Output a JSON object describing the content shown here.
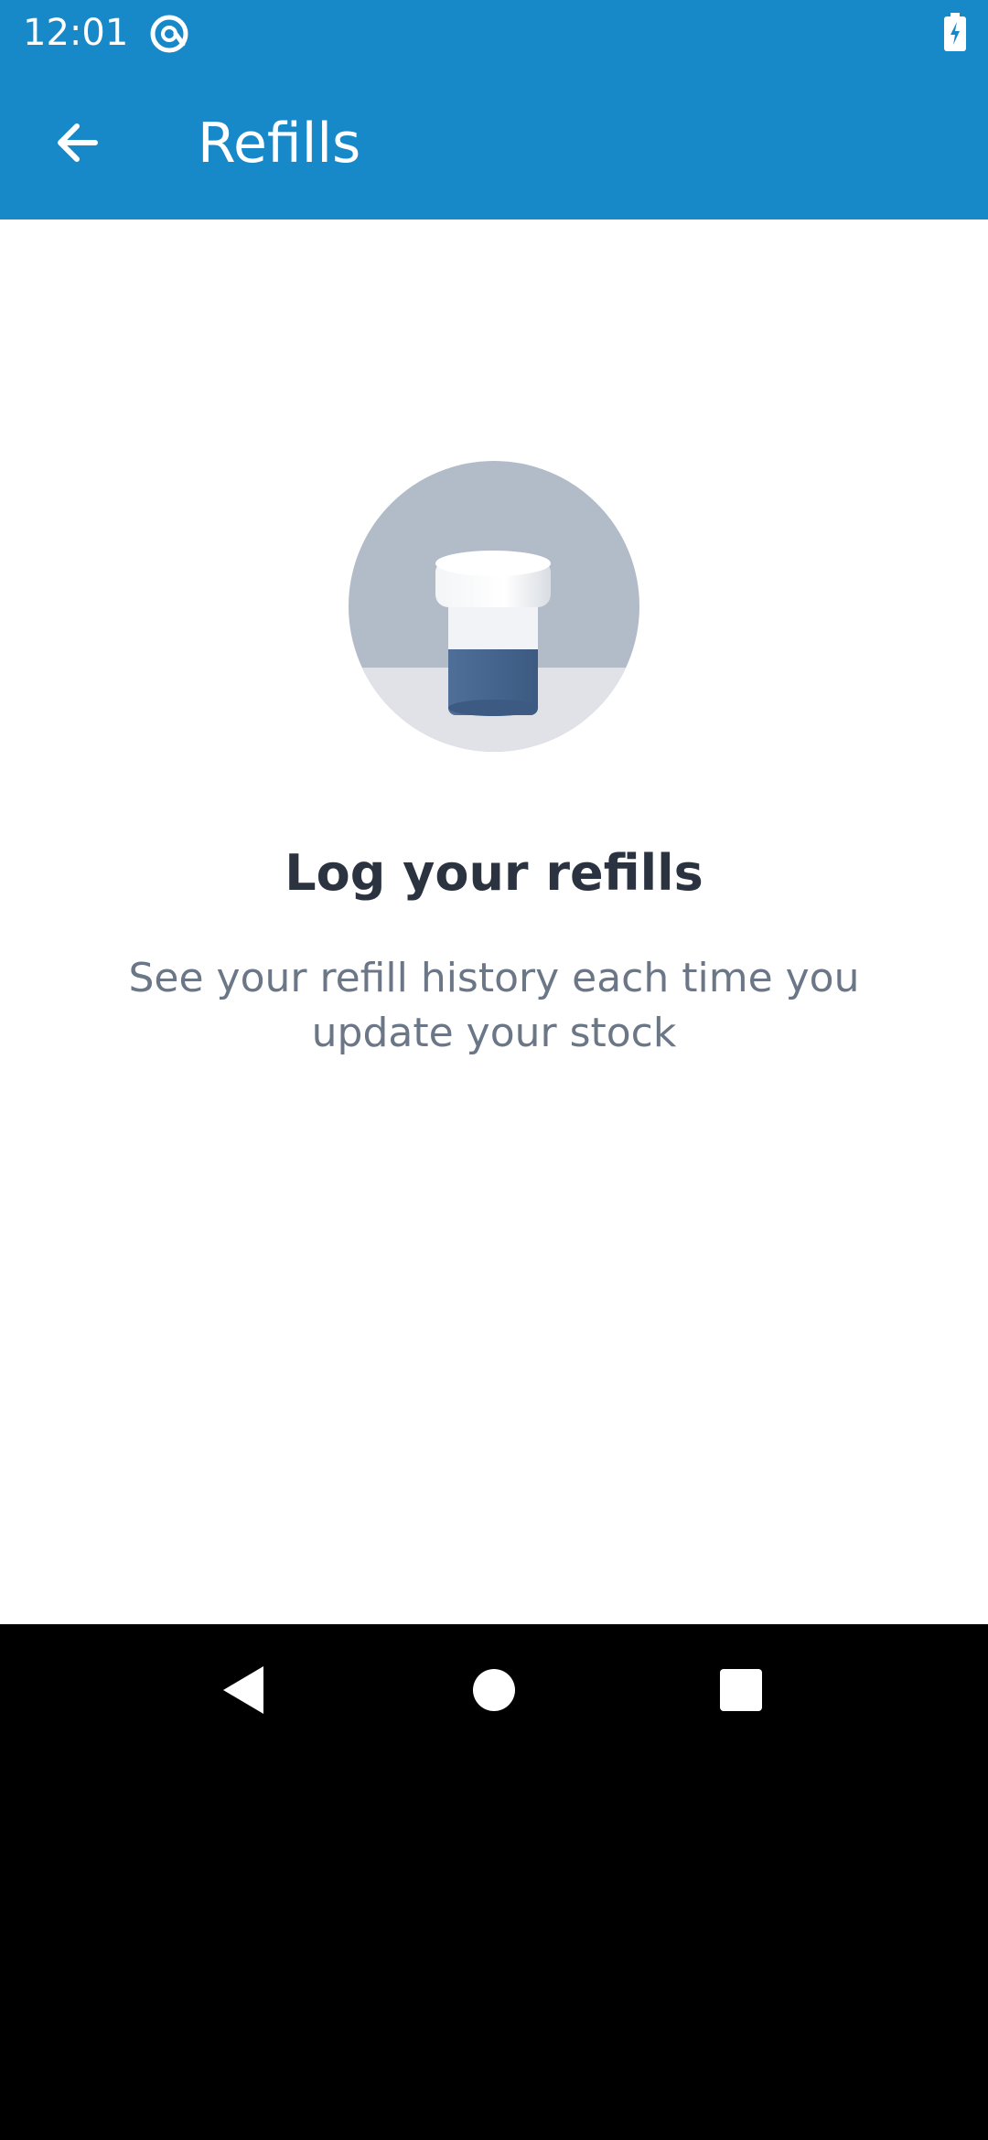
{
  "status_bar": {
    "time": "12:01",
    "app_icon": "at-sign-icon",
    "battery_icon": "battery-charging-icon"
  },
  "app_bar": {
    "back_icon": "arrow-back-icon",
    "title": "Refills",
    "color": "#1788c8"
  },
  "empty_state": {
    "illustration": "pill-bottle-icon",
    "title": "Log your refills",
    "subtitle": "See your refill history each time you update your stock"
  },
  "nav_bar": {
    "back_icon": "nav-back-icon",
    "home_icon": "nav-home-icon",
    "recents_icon": "nav-recents-icon"
  }
}
